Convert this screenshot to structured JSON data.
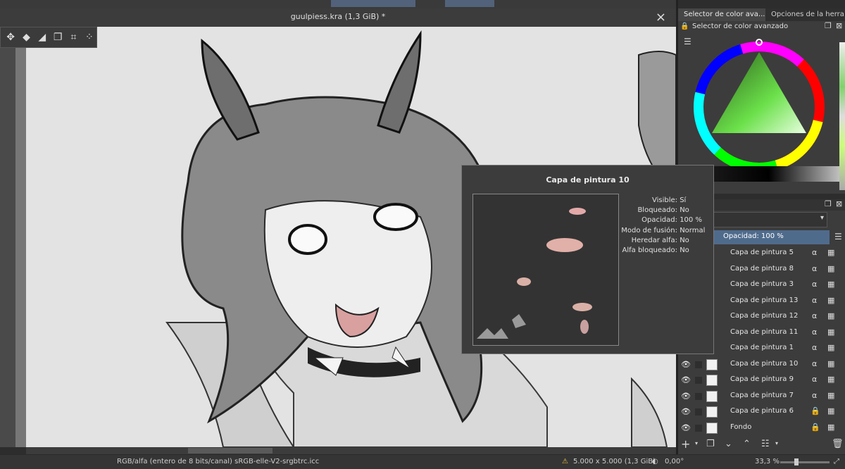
{
  "document": {
    "title": "guulpiess.kra (1,3 GiB) *"
  },
  "toolbox": {
    "icons": [
      "move-icon",
      "fill-icon",
      "eraser-icon",
      "transform-icon",
      "crop-icon",
      "more-icon"
    ]
  },
  "docker_tabs": [
    {
      "label": "Selector de color ava..."
    },
    {
      "label": "Opciones de la herra..."
    }
  ],
  "color_selector": {
    "title": "Selector de color avanzado"
  },
  "layers": {
    "opacity_label": "Opacidad: 100 %",
    "items": [
      {
        "name": "Capa de pintura 5"
      },
      {
        "name": "Capa de pintura 8"
      },
      {
        "name": "Capa de pintura 3"
      },
      {
        "name": "Capa de pintura 13"
      },
      {
        "name": "Capa de pintura 12"
      },
      {
        "name": "Capa de pintura 11"
      },
      {
        "name": "Capa de pintura 1"
      },
      {
        "name": "Capa de pintura 10"
      },
      {
        "name": "Capa de pintura 9"
      },
      {
        "name": "Capa de pintura 7"
      },
      {
        "name": "Capa de pintura 6",
        "locked": true
      },
      {
        "name": "Fondo",
        "locked": true
      }
    ]
  },
  "tooltip": {
    "title": "Capa de pintura 10",
    "props": [
      {
        "key": "Visible:",
        "value": "Sí"
      },
      {
        "key": "Bloqueado:",
        "value": "No"
      },
      {
        "key": "Opacidad:",
        "value": "100 %"
      },
      {
        "key": "Modo de fusión:",
        "value": "Normal"
      },
      {
        "key": "Heredar alfa:",
        "value": "No"
      },
      {
        "key": "Alfa bloqueado:",
        "value": "No"
      }
    ]
  },
  "status": {
    "color_model": "RGB/alfa (entero de 8 bits/canal)  sRGB-elle-V2-srgbtrc.icc",
    "size": "5.000 x 5.000 (1,3 GiB)",
    "rotation": "0,00°",
    "zoom": "33,3 %"
  },
  "colors": {
    "accent": "#52627a",
    "panel": "#3c3c3c",
    "opacity_bar": "#4f6b8c"
  }
}
